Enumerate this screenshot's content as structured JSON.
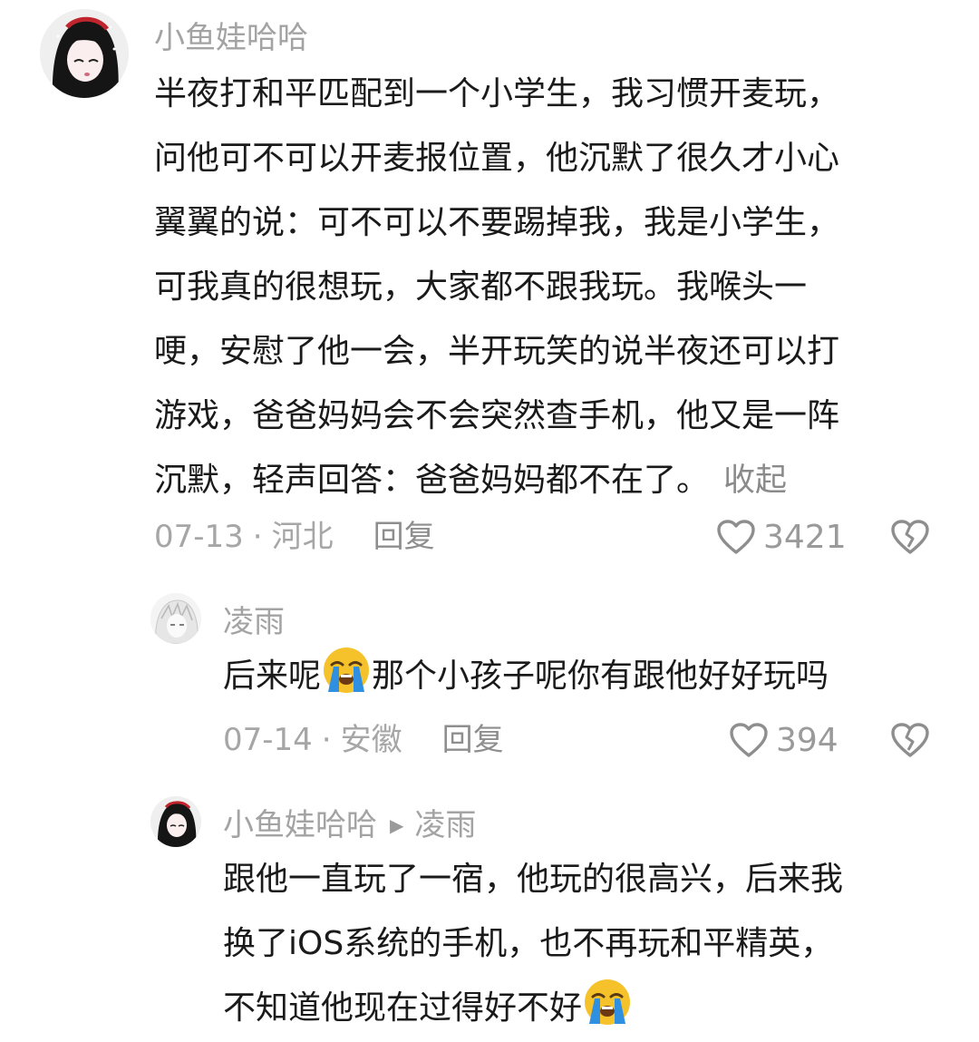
{
  "comments": [
    {
      "username": "小鱼娃哈哈",
      "lines": [
        "半夜打和平匹配到一个小学生，我习惯开麦玩，",
        "问他可不可以开麦报位置，他沉默了很久才小心",
        "翼翼的说：可不可以不要踢掉我，我是小学生，",
        "可我真的很想玩，大家都不跟我玩。我喉头一",
        "哽，安慰了他一会，半开玩笑的说半夜还可以打",
        "游戏，爸爸妈妈会不会突然查手机，他又是一阵",
        "沉默，轻声回答：爸爸妈妈都不在了。"
      ],
      "collapse_label": "收起",
      "date": "07-13",
      "location": "河北",
      "reply_label": "回复",
      "like_count": "3421"
    }
  ],
  "replies": [
    {
      "username": "凌雨",
      "text_before": "后来呢",
      "text_after": "那个小孩子呢你有跟他好好玩吗",
      "emoji_icon": "loudly-crying-face-icon",
      "date": "07-14",
      "location": "安徽",
      "reply_label": "回复",
      "like_count": "394"
    },
    {
      "username": "小鱼娃哈哈",
      "reply_to": "凌雨",
      "lines": [
        "跟他一直玩了一宿，他玩的很高兴，后来我",
        "换了iOS系统的手机，也不再玩和平精英，",
        "不知道他现在过得好不好"
      ],
      "emoji_icon": "loudly-crying-face-icon"
    }
  ],
  "colors": {
    "text": "#1a1a1a",
    "muted": "#a3a3a3",
    "icon": "#8e8e8e",
    "emoji_face": "#f5c22c",
    "emoji_tears": "#2f8fe0"
  }
}
